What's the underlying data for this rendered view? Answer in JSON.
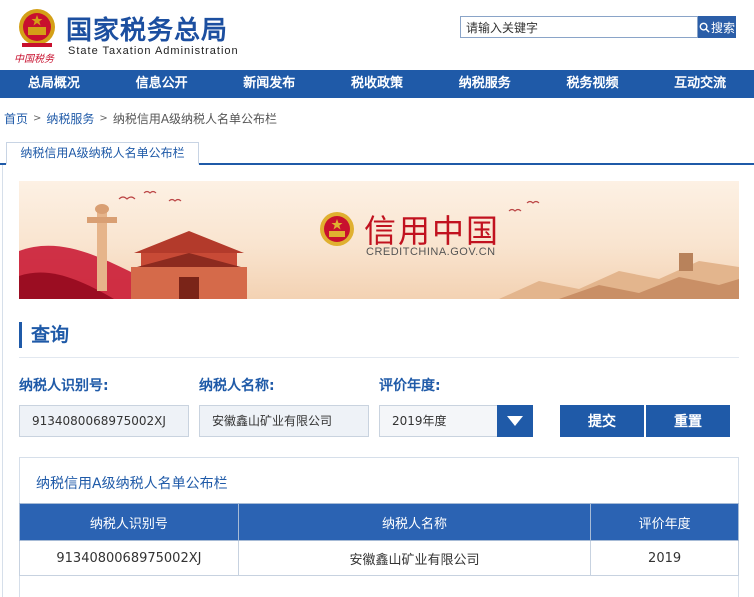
{
  "header": {
    "title": "国家税务总局",
    "subtitle": "State Taxation Administration",
    "logo_text": "中国税务",
    "search_placeholder": "请输入关键字",
    "search_button": "搜索"
  },
  "nav": {
    "items": [
      "总局概况",
      "信息公开",
      "新闻发布",
      "税收政策",
      "纳税服务",
      "税务视频",
      "互动交流"
    ]
  },
  "breadcrumb": {
    "items": [
      "首页",
      "纳税服务",
      "纳税信用A级纳税人名单公布栏"
    ]
  },
  "tab": {
    "label": "纳税信用A级纳税人名单公布栏"
  },
  "banner": {
    "title": "信用中国",
    "url": "CREDITCHINA.GOV.CN"
  },
  "query": {
    "heading": "查询",
    "taxpayer_id_label": "纳税人识别号:",
    "taxpayer_id_value": "9134080068975002XJ",
    "taxpayer_name_label": "纳税人名称:",
    "taxpayer_name_value": "安徽鑫山矿业有限公司",
    "year_label": "评价年度:",
    "year_value": "2019年度",
    "submit_label": "提交",
    "reset_label": "重置"
  },
  "results": {
    "title": "纳税信用A级纳税人名单公布栏",
    "columns": [
      "纳税人识别号",
      "纳税人名称",
      "评价年度"
    ],
    "rows": [
      [
        "9134080068975002XJ",
        "安徽鑫山矿业有限公司",
        "2019"
      ]
    ]
  },
  "colors": {
    "brand_blue": "#1f5aa8",
    "table_header": "#2b63b3",
    "banner_red": "#c1121f"
  }
}
